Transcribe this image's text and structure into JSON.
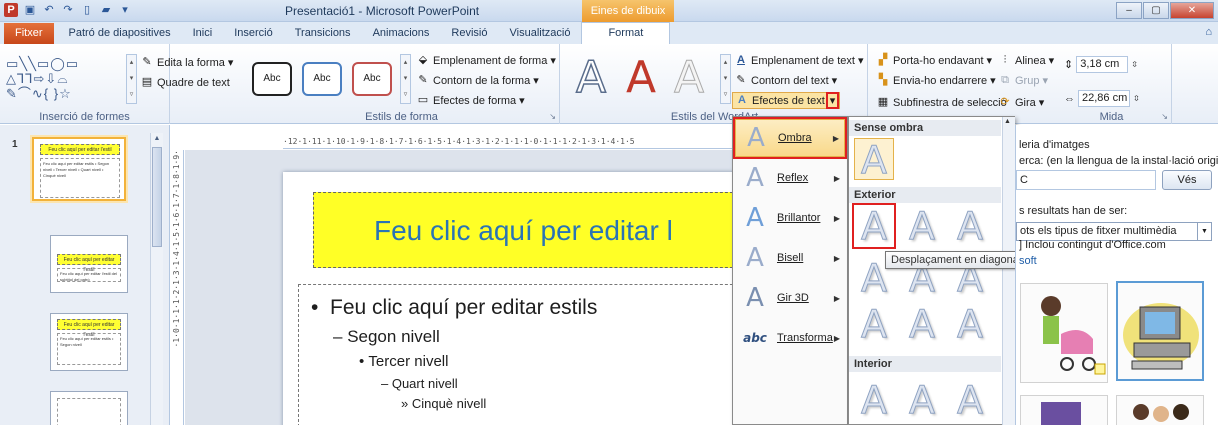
{
  "titlebar": {
    "title": "Presentació1 - Microsoft PowerPoint",
    "context_group": "Eines de dibuix",
    "app_letter": "P"
  },
  "tabs": [
    {
      "label": "Fitxer"
    },
    {
      "label": "Patró de diapositives"
    },
    {
      "label": "Inici"
    },
    {
      "label": "Inserció"
    },
    {
      "label": "Transicions"
    },
    {
      "label": "Animacions"
    },
    {
      "label": "Revisió"
    },
    {
      "label": "Visualització"
    },
    {
      "label": "Format"
    }
  ],
  "ribbon": {
    "insert_shapes": {
      "label": "Inserció de formes",
      "edit_shape": "Edita la forma",
      "text_box": "Quadre de text"
    },
    "shape_styles": {
      "label": "Estils de forma",
      "abc": "Abc",
      "fill": "Emplenament de forma",
      "outline": "Contorn de la forma",
      "effects": "Efectes de forma"
    },
    "wordart": {
      "label": "Estils del WordArt",
      "text_fill": "Emplenament de text",
      "text_outline": "Contorn del text",
      "text_effects": "Efectes de text"
    },
    "arrange": {
      "bring_forward": "Porta-ho endavant",
      "send_backward": "Envia-ho endarrere",
      "selection_pane": "Subfinestra de selecció",
      "align": "Alinea",
      "group": "Grup",
      "rotate": "Gira"
    },
    "size": {
      "label": "Mida",
      "height": "3,18 cm",
      "width": "22,86 cm"
    }
  },
  "thumbnails": [
    {
      "num": "1",
      "title": "Feu clic aquí per editar l'estil",
      "body": "Feu clic aquí per editar estils • Segon nivell • Tercer nivell • Quart nivell • Cinquè nivell"
    },
    {
      "num": "",
      "title": "Feu clic aquí per editar l'estil",
      "body": "Feu clic aquí per editar l'estil del subtítol del patró"
    },
    {
      "num": "",
      "title": "Feu clic aquí per editar l'estil",
      "body": "Feu clic aquí per editar estils • Segon nivell"
    },
    {
      "num": "",
      "title": "",
      "body": ""
    }
  ],
  "hruler_text": "·12·1·11·1·10·1·9·1·8·1·7·1·6·1·5·1·4·1·3·1·2·1·1·1·0·1·1·1·2·1·3·1·4·1·5",
  "vruler_text": "·1·0·1·1·1·2·1·3·1·4·1·5·1·6·1·7·1·8·1·9·",
  "slide": {
    "title": "Feu clic aquí per editar l",
    "lv1": "Feu clic aquí per editar estils",
    "lv2": "Segon nivell",
    "lv3": "Tercer nivell",
    "lv4": "Quart nivell",
    "lv5": "Cinquè nivell"
  },
  "text_effects_menu": [
    {
      "label": "Ombra",
      "icon": "A",
      "active": true
    },
    {
      "label": "Reflex",
      "icon": "A"
    },
    {
      "label": "Brillantor",
      "icon": "A"
    },
    {
      "label": "Bisell",
      "icon": "A"
    },
    {
      "label": "Gir 3D",
      "icon": "A"
    },
    {
      "label": "Transforma",
      "icon": "abc"
    }
  ],
  "shadow_submenu": {
    "no_shadow": "Sense ombra",
    "outer": "Exterior",
    "inner": "Interior",
    "tooltip": "Desplaçament en diagonal cap al final a la dreta"
  },
  "clip_pane": {
    "title": "leria d'imatges",
    "search_label": "erca: (en la llengua de la instal·lació original)",
    "search_value": "C",
    "go": "Vés",
    "results_label": "s resultats han de ser:",
    "results_value": "ots els tipus de fitxer multimèdia",
    "include_office": "Inclou contingut d'Office.com",
    "link": "soft"
  }
}
